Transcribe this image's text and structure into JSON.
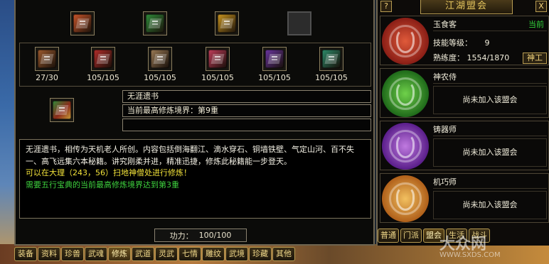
{
  "top_slots": [
    {
      "icon": "red-book-icon",
      "color": "#c8552a"
    },
    {
      "icon": "green-scroll-icon",
      "color": "#2f8a3a"
    },
    {
      "icon": "gold-chest-icon",
      "color": "#c99520"
    },
    {
      "icon": "empty-slot-icon",
      "color": "#2c2c2c"
    }
  ],
  "chapters": [
    {
      "icon": "brown-book-icon",
      "color": "#9c5a2e",
      "count": "27/30"
    },
    {
      "icon": "red-book-icon",
      "color": "#b22d2a",
      "count": "105/105"
    },
    {
      "icon": "tan-book-icon",
      "color": "#9a7a55",
      "count": "105/105"
    },
    {
      "icon": "pink-book-icon",
      "color": "#c03d5a",
      "count": "105/105"
    },
    {
      "icon": "purple-book-icon",
      "color": "#6a36a0",
      "count": "105/105"
    },
    {
      "icon": "teal-book-icon",
      "color": "#2d8a6a",
      "count": "105/105"
    }
  ],
  "selected": {
    "icon": "green-red-scroll-icon",
    "name": "无涯遗书",
    "realm": "当前最高修炼境界：第9重",
    "extra": ""
  },
  "description": {
    "text": "无涯遗书，相传为天机老人所创。内容包括倒海翻江、滴水穿石、铜墙铁壁、气定山河、百不失一、高飞远集六本秘籍。讲究刚柔并进，精准迅捷，修炼此秘籍能一步登天。",
    "location": "可以在大理（243，56）扫地神僧处进行修炼！",
    "requirement": "需要五行宝典的当前最高修炼境界达到第3重"
  },
  "power": {
    "label": "功力：",
    "value": "100/100"
  },
  "bottom_tabs": [
    "装备",
    "资料",
    "珍兽",
    "武魂",
    "修炼",
    "武道",
    "灵武",
    "七情",
    "雕纹",
    "武境",
    "珍藏",
    "其他"
  ],
  "active_tab": "修炼",
  "right_panel": {
    "title": "江湖盟会",
    "help_btn": "?",
    "close_btn": "X",
    "guild_current": {
      "name": "玉食客",
      "status": "当前",
      "skill_label": "技能等级：",
      "skill_level": "9",
      "proficiency_label": "熟练度：",
      "proficiency": "1554/1870",
      "button": "神工",
      "emblem_color": "#c0352a"
    },
    "guilds": [
      {
        "name": "神农侍",
        "status": "尚未加入该盟会",
        "emblem_color": "#2f7a2a"
      },
      {
        "name": "铸器师",
        "status": "尚未加入该盟会",
        "emblem_color": "#7d3aa0"
      },
      {
        "name": "机巧师",
        "status": "尚未加入该盟会",
        "emblem_color": "#d0801a"
      }
    ],
    "tabs": [
      "普通",
      "门派",
      "盟会",
      "生活",
      "战斗"
    ],
    "active_tab": "盟会"
  },
  "watermark": {
    "text": "大众网",
    "sub": "WWW.SXDS.COM"
  }
}
